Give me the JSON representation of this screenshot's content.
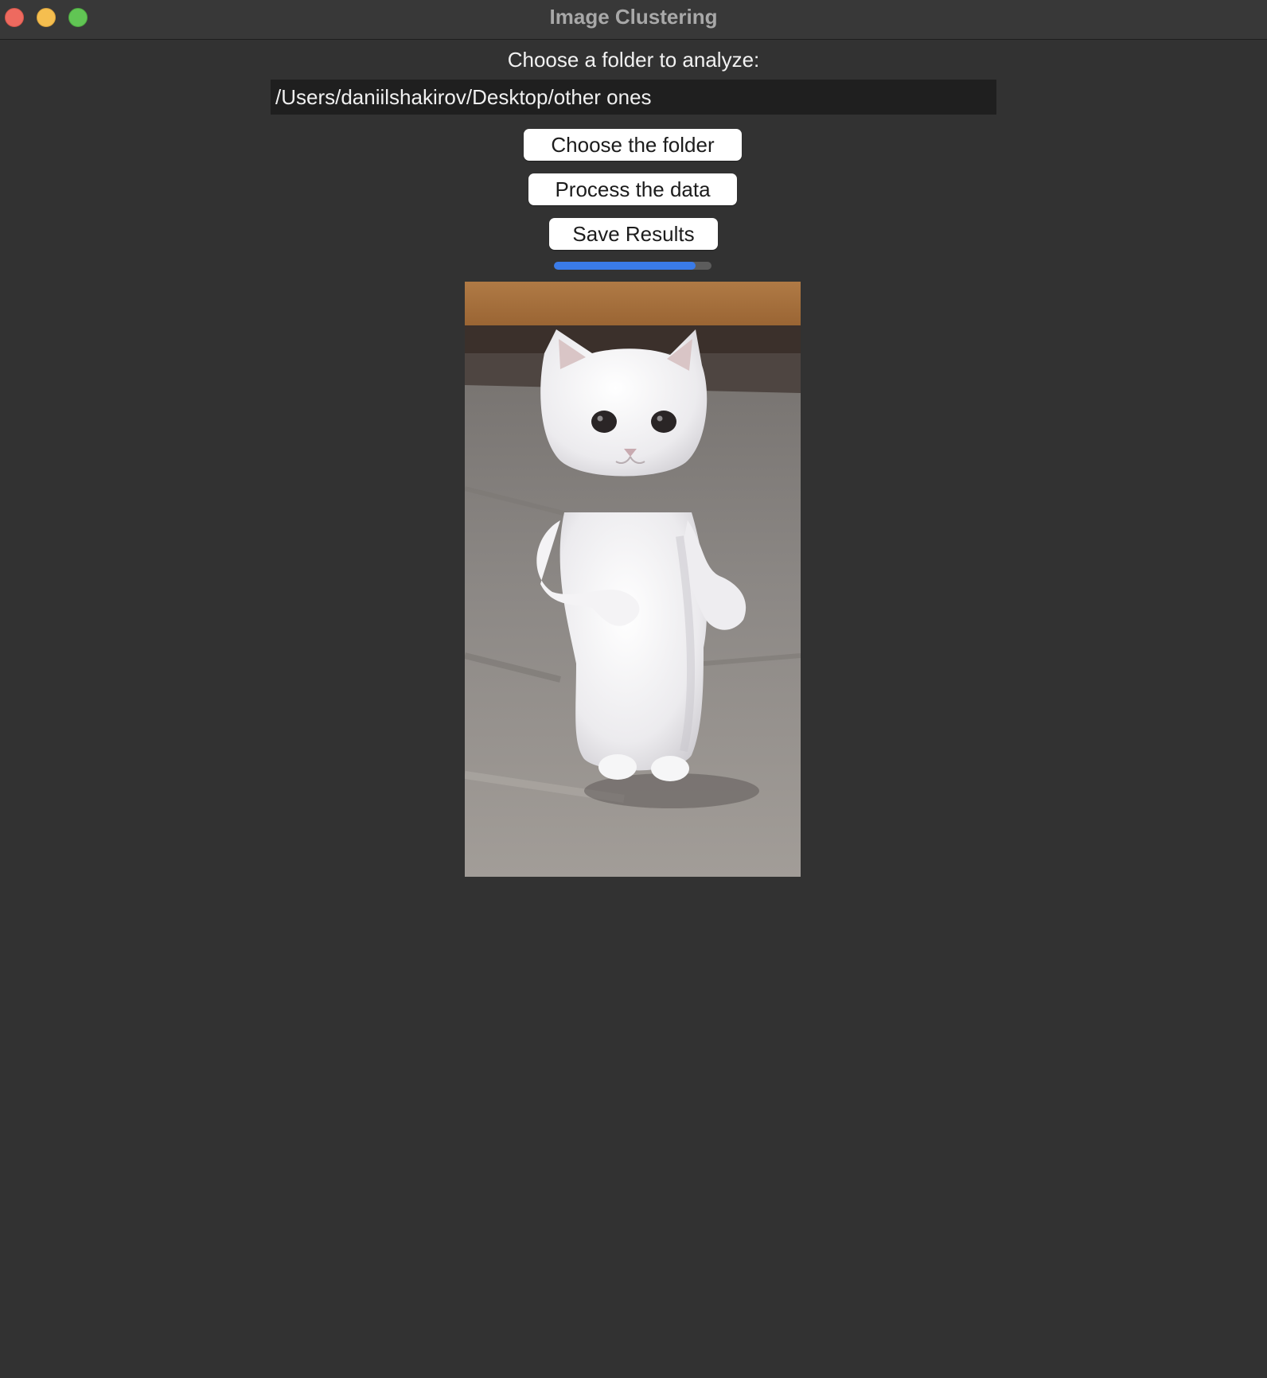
{
  "window": {
    "title": "Image Clustering"
  },
  "main": {
    "prompt": "Choose a folder to analyze:",
    "folder_path": "/Users/daniilshakirov/Desktop/other ones",
    "choose_button": "Choose the folder",
    "process_button": "Process the data",
    "save_button": "Save Results",
    "progress_percent": 90
  },
  "preview": {
    "icon": "cat-photo-image"
  },
  "colors": {
    "background": "#323232",
    "accent": "#3a7be8",
    "close": "#ee6a5f",
    "minimize": "#f5be4f",
    "zoom": "#61c554"
  }
}
